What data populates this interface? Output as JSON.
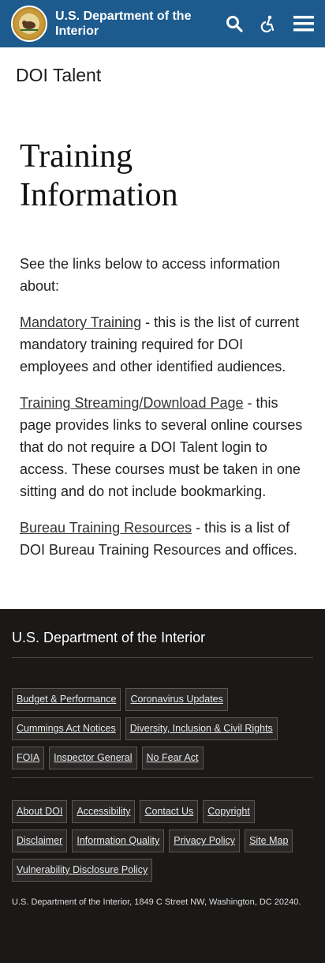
{
  "header": {
    "title": "U.S. Department of the Interior",
    "seal_icon": "doi-seal-icon",
    "search_icon": "search-icon",
    "accessibility_icon": "accessibility-icon",
    "menu_icon": "hamburger-menu-icon",
    "bg_color": "#1d5b8e"
  },
  "site_name": "DOI Talent",
  "main": {
    "title_line1": "Training",
    "title_line2": "Information",
    "intro": "See the links below to access information about:",
    "items": [
      {
        "link": "Mandatory Training",
        "text": " - this is the list of current mandatory training required for DOI employees and other identified audiences."
      },
      {
        "link": "Training Streaming/Download Page",
        "text": " - this page provides links to several online courses that do not require a DOI Talent login to access.  These courses must be taken in one sitting and do not include bookmarking."
      },
      {
        "link": "Bureau Training Resources",
        "text": " - this is a list of DOI Bureau Training Resources and offices."
      }
    ]
  },
  "footer": {
    "title": "U.S. Department of the Interior",
    "links_group1": [
      "Budget & Performance",
      "Coronavirus Updates",
      "Cummings Act Notices",
      "Diversity, Inclusion & Civil Rights",
      "FOIA",
      "Inspector General",
      "No Fear Act"
    ],
    "links_group2": [
      "About DOI",
      "Accessibility",
      "Contact Us",
      "Copyright",
      "Disclaimer",
      "Information Quality",
      "Privacy Policy",
      "Site Map",
      "Vulnerability Disclosure Policy"
    ],
    "address": "U.S. Department of the Interior, 1849 C Street NW, Washington, DC 20240.",
    "bg_color": "#1b1918"
  }
}
